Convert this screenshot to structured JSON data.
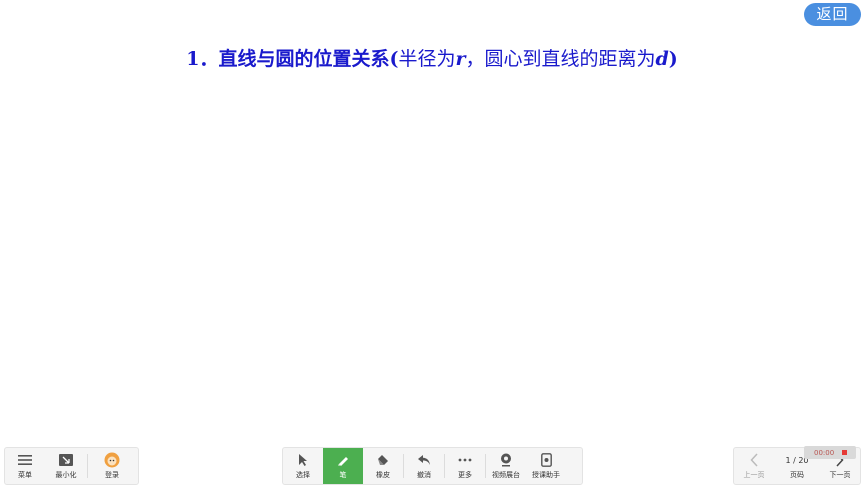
{
  "slide": {
    "title_num": "1．",
    "title_bold1": "直线与圆的位置关系(",
    "title_plain1": "半径为",
    "title_var_r": "r",
    "title_plain2": "，圆心到直线的距离为",
    "title_var_d": "d",
    "title_bold2": ")"
  },
  "back_button": "返回",
  "left_toolbar": {
    "menu": "菜单",
    "minimize": "最小化",
    "login": "登录"
  },
  "center_toolbar": {
    "select": "选择",
    "pen": "笔",
    "eraser": "橡皮",
    "undo": "撤消",
    "more": "更多",
    "video_booth": "视频展台",
    "teaching_assistant": "授课助手"
  },
  "right_toolbar": {
    "prev": "上一页",
    "page_indicator": "1 / 20",
    "page_label": "页码",
    "next": "下一页"
  },
  "timer": {
    "time": "00:00"
  },
  "colors": {
    "title": "#1a1acc",
    "active_tool": "#4caf50",
    "back_button": "#4a8fe0"
  }
}
